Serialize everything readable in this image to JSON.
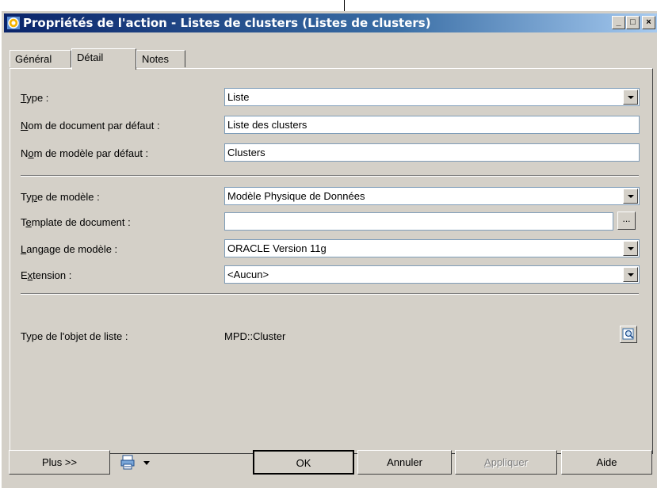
{
  "window": {
    "title": "Propriétés de l'action - Listes de clusters (Listes de clusters)",
    "controls": {
      "minimize": "_",
      "maximize": "□",
      "close": "×"
    }
  },
  "tabs": [
    {
      "label": "Général",
      "active": false
    },
    {
      "label": "Détail",
      "active": true
    },
    {
      "label": "Notes",
      "active": false
    }
  ],
  "form": {
    "type": {
      "label_u": "T",
      "label_rest": "ype :",
      "value": "Liste"
    },
    "doc_name": {
      "label_u": "N",
      "label_rest": "om de document par défaut :",
      "value": "Liste des clusters"
    },
    "model_name": {
      "label_pre": "N",
      "label_u": "o",
      "label_rest": "m de modèle par défaut :",
      "value": "Clusters"
    },
    "model_type": {
      "label_pre": "Ty",
      "label_u": "p",
      "label_rest": "e de modèle :",
      "value": "Modèle Physique de Données"
    },
    "doc_template": {
      "label_pre": "T",
      "label_u": "e",
      "label_rest": "mplate de document :",
      "value": "",
      "browse": "..."
    },
    "model_lang": {
      "label_u": "L",
      "label_rest": "angage de modèle :",
      "value": "ORACLE Version 11g"
    },
    "extension": {
      "label_pre": "E",
      "label_u": "x",
      "label_rest": "tension :",
      "value": "<Aucun>"
    },
    "list_object_type": {
      "label": "Type de l'objet de liste :",
      "value": "MPD::Cluster"
    }
  },
  "footer": {
    "more": "Plus >>",
    "ok": "OK",
    "cancel": "Annuler",
    "apply_u": "A",
    "apply_rest": "ppliquer",
    "help": "Aide"
  }
}
